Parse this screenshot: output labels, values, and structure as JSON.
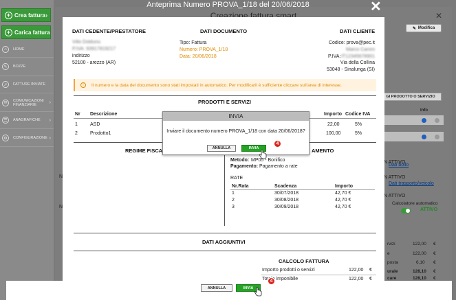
{
  "sidebar": {
    "crea_fattura": "Crea fattura",
    "carica_fattura": "Carica fattura",
    "items": [
      {
        "label": "HOME",
        "icon": "home-icon"
      },
      {
        "label": "BOZZE",
        "icon": "drafts-icon"
      },
      {
        "label": "FATTURE INVIATE",
        "icon": "sent-icon"
      },
      {
        "label": "COMUNICAZIONI FINANZIARIE",
        "icon": "communications-icon"
      },
      {
        "label": "ANAGRAFICHE",
        "icon": "registry-icon"
      },
      {
        "label": "CONFIGURAZIONE",
        "icon": "settings-icon"
      }
    ]
  },
  "background": {
    "title": "Creazione fattura smart",
    "modifica": "Modifica",
    "aggiungi": "GI PRODOTTO O SERVIZIO",
    "info_header": "Info",
    "nc_labels": [
      "NC",
      "NC"
    ],
    "attivo_1": "N ATTIVO",
    "dati_bollo": "Dati bollo",
    "attivo_2": "N ATTIVO",
    "dati_trasporto": "Dati trasporto/veicolo",
    "attivo_3": "N ATTIVO",
    "calcolatore": "Calcolatore automatico",
    "attivo_4": "ATTIVO",
    "totals": [
      {
        "label": "rvizi",
        "value": "122,00",
        "unit": "€"
      },
      {
        "label": "e",
        "value": "122,00",
        "unit": "€"
      },
      {
        "label": "posta",
        "value": "6,10",
        "unit": "€"
      },
      {
        "label": "urale",
        "value": "128,10",
        "unit": "€"
      },
      {
        "label": "care",
        "value": "128,10",
        "unit": "€"
      }
    ]
  },
  "preview": {
    "window_title": "Anteprima Numero PROVA_1/18 del 20/06/2018",
    "cedente": {
      "heading": "DATI CEDENTE/PRESTATORE",
      "name": "Villo Doldunu",
      "piva": "P.IVA: 93917819217",
      "indirizzo": "indirizzo",
      "city": "52100 - arezzo (AR)"
    },
    "documento": {
      "heading": "DATI DOCUMENTO",
      "tipo": "Tipo: Fattura",
      "numero": "Numero: PROVA_1/18",
      "data": "Data: 20/06/2018"
    },
    "cliente": {
      "heading": "DATI CLIENTE",
      "codice": "Codice: prova@pec.it",
      "name": "Marco Caroni",
      "piva_label": "P.IVA:",
      "piva_value": "IT12345678901",
      "address": "Via della Collina",
      "city": "53048 - Sinalunga (SI)"
    },
    "notice": "Il numero e la data del documento sono stati impostati in automatico. Per modificarli è sufficiente cliccare sull'area di interesse.",
    "prodotti": {
      "heading": "PRODOTTI E SERVIZI",
      "columns": [
        "Nr",
        "Descrizione",
        "Importo",
        "Codice IVA"
      ],
      "rows": [
        {
          "nr": "1",
          "desc": "ASD",
          "importo": "22,00",
          "iva": "5%"
        },
        {
          "nr": "2",
          "desc": "Prodotto1",
          "importo": "100,00",
          "iva": "5%"
        }
      ]
    },
    "regime_heading": "REGIME FISCALE",
    "pagamento": {
      "heading": "AMENTO",
      "metodo_label": "Metodo:",
      "metodo_value": "MP05 - Bonifico",
      "pagamento_label": "Pagamento:",
      "pagamento_value": "Pagamento a rate",
      "rate_label": "RATE",
      "columns": [
        "Nr.Rata",
        "Scadenza",
        "Importo"
      ],
      "rows": [
        {
          "nr": "1",
          "scadenza": "30/07/2018",
          "importo": "42,70 €"
        },
        {
          "nr": "2",
          "scadenza": "30/08/2018",
          "importo": "42,70 €"
        },
        {
          "nr": "3",
          "scadenza": "30/09/2018",
          "importo": "42,70 €"
        }
      ]
    },
    "aggiuntivi_heading": "DATI AGGIUNTIVI",
    "calcolo": {
      "heading": "CALCOLO FATTURA",
      "rows": [
        {
          "label": "Importo prodotti o servizi",
          "value": "122,00",
          "unit": "€"
        },
        {
          "label": "Totale imponibile",
          "value": "122,00",
          "unit": "€"
        }
      ]
    }
  },
  "dialog": {
    "title": "INVIA",
    "message": "Inviare il documento numero PROVA_1/18 con data 20/06/2018?",
    "annulla": "ANNULLA",
    "invia": "INVIA",
    "step": "4"
  },
  "bottom": {
    "annulla": "ANNULLA",
    "invia": "INVIA",
    "step": "4"
  },
  "colors": {
    "green": "#24a324",
    "orange": "#e08a00",
    "step_red": "#d9251c"
  }
}
